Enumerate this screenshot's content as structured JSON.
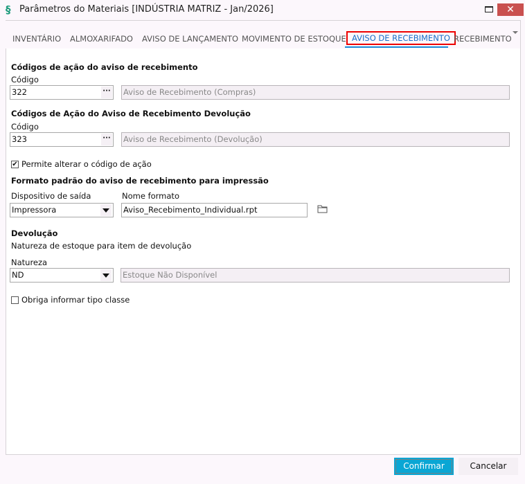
{
  "window": {
    "title": "Parâmetros do Materiais [INDÚSTRIA MATRIZ - Jan/2026]",
    "close": "✕"
  },
  "tabs": [
    {
      "label": "INVENTÁRIO"
    },
    {
      "label": "ALMOXARIFADO"
    },
    {
      "label": "AVISO DE LANÇAMENTO"
    },
    {
      "label": "MOVIMENTO DE ESTOQUE"
    },
    {
      "label": "AVISO DE RECEBIMENTO",
      "active": true
    },
    {
      "label": "RECEBIMENTO"
    }
  ],
  "section1": {
    "title": "Códigos de ação do aviso de recebimento",
    "code_label": "Código",
    "code": "322",
    "lookup": "···",
    "description": "Aviso de Recebimento (Compras)"
  },
  "section2": {
    "title": "Códigos de Ação do Aviso de Recebimento Devolução",
    "code_label": "Código",
    "code": "323",
    "lookup": "···",
    "description": "Aviso de Recebimento (Devolução)"
  },
  "allow_change": {
    "label": "Permite alterar o código de ação",
    "checked": true
  },
  "format": {
    "title": "Formato padrão do aviso de recebimento para impressão",
    "device_label": "Dispositivo de saída",
    "device": "Impressora",
    "name_label": "Nome formato",
    "name": "Aviso_Recebimento_Individual.rpt"
  },
  "devolucao": {
    "title": "Devolução",
    "subtitle": "Natureza de estoque para item de devolução",
    "natureza_label": "Natureza",
    "natureza": "ND",
    "natureza_desc": "Estoque Não Disponível"
  },
  "require_class": {
    "label": "Obriga informar tipo classe",
    "checked": false
  },
  "buttons": {
    "confirm": "Confirmar",
    "cancel": "Cancelar"
  },
  "colors": {
    "accent": "#0aa6d4",
    "active_tab": "#1a6fc9",
    "highlight": "#e00000",
    "close": "#c9504f"
  }
}
